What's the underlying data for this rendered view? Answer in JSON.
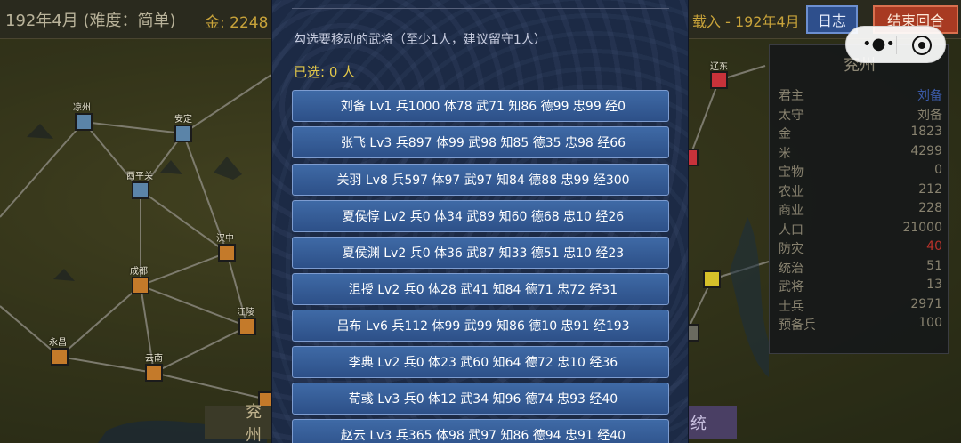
{
  "topbar": {
    "date": "192年4月 (难度：简单)",
    "gold": "金: 2248",
    "loaded": "载入 - 192年4月",
    "log_label": "日志",
    "end_turn_label": "结束回合"
  },
  "map": {
    "cities": [
      {
        "name": "凉州",
        "color": "#5b84a8"
      },
      {
        "name": "安定",
        "color": "#5b84a8"
      },
      {
        "name": "西平关",
        "color": "#5b84a8"
      },
      {
        "name": "汉中",
        "color": "#c47a2a"
      },
      {
        "name": "成都",
        "color": "#c47a2a"
      },
      {
        "name": "永昌",
        "color": "#c47a2a"
      },
      {
        "name": "云南",
        "color": "#c47a2a"
      },
      {
        "name": "江陵",
        "color": "#c47a2a"
      },
      {
        "name": "",
        "color": "#c47a2a"
      },
      {
        "name": "辽东",
        "color": "#c8323a"
      },
      {
        "name": "",
        "color": "#c8323a"
      },
      {
        "name": "",
        "color": "#d6c02a"
      }
    ]
  },
  "modal": {
    "hint": "勾选要移动的武将（至少1人，建议留守1人）",
    "selected": "已选: 0 人",
    "checkbox_glyph": "",
    "generals": [
      "刘备 Lv1 兵1000 体78 武71 知86 德99 忠99 经0",
      "张飞 Lv3 兵897 体99 武98 知85 德35 忠98 经66",
      "关羽 Lv8 兵597 体97 武97 知84 德88 忠99 经300",
      "夏侯惇 Lv2 兵0 体34 武89 知60 德68 忠10 经26",
      "夏侯渊 Lv2 兵0 体36 武87 知33 德51 忠10 经23",
      "沮授 Lv2 兵0 体28 武41 知84 德71 忠72 经31",
      "吕布 Lv6 兵112 体99 武99 知86 德10 忠91 经193",
      "李典 Lv2 兵0 体23 武60 知64 德72 忠10 经36",
      "荀彧 Lv3 兵0 体12 武34 知96 德74 忠93 经40",
      "赵云 Lv3 兵365 体98 武97 知86 德94 忠91 经40"
    ]
  },
  "info": {
    "title": "兖州",
    "rows": [
      {
        "k": "君主",
        "v": "刘备",
        "color": "#3b5aa8"
      },
      {
        "k": "太守",
        "v": "刘备",
        "color": "#88826f"
      },
      {
        "k": "金",
        "v": "1823",
        "color": "#88826f"
      },
      {
        "k": "米",
        "v": "4299",
        "color": "#88826f"
      },
      {
        "k": "宝物",
        "v": "0",
        "color": "#88826f"
      },
      {
        "k": "农业",
        "v": "212",
        "color": "#88826f"
      },
      {
        "k": "商业",
        "v": "228",
        "color": "#88826f"
      },
      {
        "k": "人口",
        "v": "21000",
        "color": "#88826f"
      },
      {
        "k": "防灾",
        "v": "40",
        "color": "#b8322a"
      },
      {
        "k": "统治",
        "v": "51",
        "color": "#88826f"
      },
      {
        "k": "武将",
        "v": "13",
        "color": "#88826f"
      },
      {
        "k": "士兵",
        "v": "2971",
        "color": "#88826f"
      },
      {
        "k": "预备兵",
        "v": "100",
        "color": "#88826f"
      }
    ]
  },
  "bottom": {
    "left_label": "兖州",
    "right_label": "统"
  },
  "capsule": {
    "more_icon": "more-dots-icon",
    "close_icon": "close-target-icon"
  }
}
